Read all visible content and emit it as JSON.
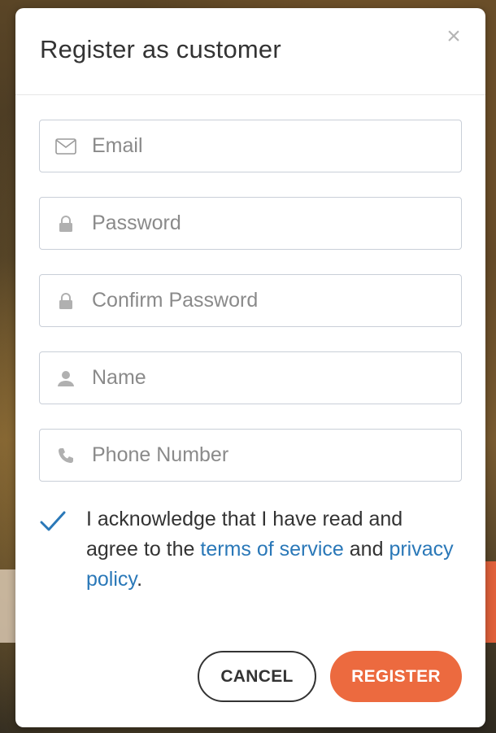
{
  "modal": {
    "title": "Register as customer",
    "close_glyph": "×"
  },
  "fields": {
    "email": {
      "placeholder": "Email",
      "icon": "envelope-icon"
    },
    "password": {
      "placeholder": "Password",
      "icon": "lock-icon"
    },
    "confirm_password": {
      "placeholder": "Confirm Password",
      "icon": "lock-icon"
    },
    "name": {
      "placeholder": "Name",
      "icon": "user-icon"
    },
    "phone": {
      "placeholder": "Phone Number",
      "icon": "phone-icon"
    }
  },
  "agreement": {
    "checked": true,
    "text_before": "I acknowledge that I have read and agree to the ",
    "terms_link": "terms of service",
    "text_middle": " and ",
    "privacy_link": "privacy policy",
    "text_after": "."
  },
  "buttons": {
    "cancel": "CANCEL",
    "register": "REGISTER"
  },
  "colors": {
    "accent": "#ec6a3f",
    "link": "#2a78b8",
    "check": "#2a78b8",
    "border": "#c9cfd8"
  }
}
